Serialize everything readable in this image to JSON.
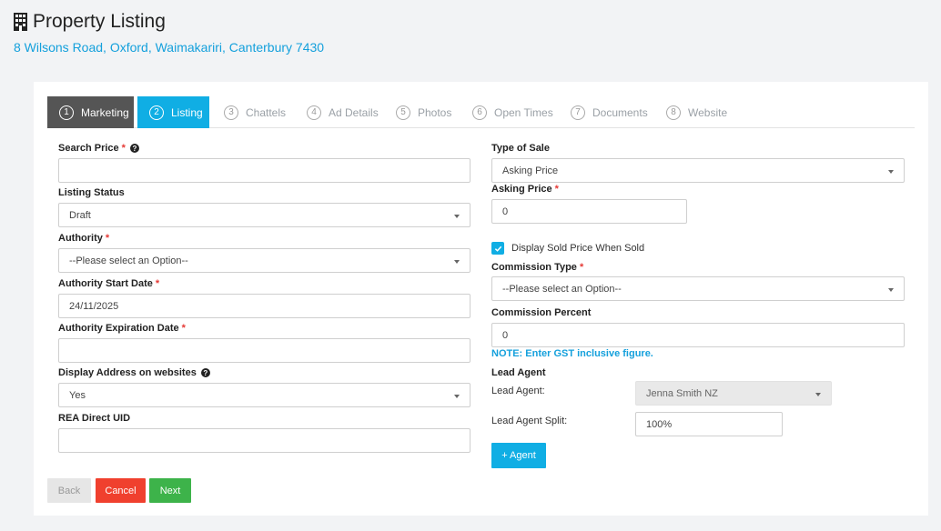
{
  "header": {
    "title": "Property Listing",
    "address": "8 Wilsons Road, Oxford, Waimakariri, Canterbury 7430"
  },
  "tabs": [
    {
      "num": "1",
      "label": "Marketing",
      "state": "done"
    },
    {
      "num": "2",
      "label": "Listing",
      "state": "active"
    },
    {
      "num": "3",
      "label": "Chattels",
      "state": "inactive"
    },
    {
      "num": "4",
      "label": "Ad Details",
      "state": "inactive"
    },
    {
      "num": "5",
      "label": "Photos",
      "state": "inactive"
    },
    {
      "num": "6",
      "label": "Open Times",
      "state": "inactive"
    },
    {
      "num": "7",
      "label": "Documents",
      "state": "inactive"
    },
    {
      "num": "8",
      "label": "Website",
      "state": "inactive"
    }
  ],
  "left": {
    "search_price": {
      "label": "Search Price",
      "value": ""
    },
    "listing_status": {
      "label": "Listing Status",
      "value": "Draft"
    },
    "authority": {
      "label": "Authority",
      "value": "--Please select an Option--"
    },
    "authority_start": {
      "label": "Authority Start Date",
      "value": "24/11/2025"
    },
    "authority_expiry": {
      "label": "Authority Expiration Date",
      "value": ""
    },
    "display_address": {
      "label": "Display Address on websites",
      "value": "Yes"
    },
    "rea_uid": {
      "label": "REA Direct UID",
      "value": ""
    }
  },
  "right": {
    "type_of_sale": {
      "label": "Type of Sale",
      "value": "Asking Price"
    },
    "asking_price": {
      "label": "Asking Price",
      "value": "0"
    },
    "display_sold": {
      "label": "Display Sold Price When Sold",
      "checked": true
    },
    "commission_type": {
      "label": "Commission Type",
      "value": "--Please select an Option--"
    },
    "commission_percent": {
      "label": "Commission Percent",
      "value": "0"
    },
    "note": "NOTE: Enter GST inclusive figure.",
    "lead_agent_heading": "Lead Agent",
    "lead_agent": {
      "label": "Lead Agent:",
      "value": "Jenna Smith NZ"
    },
    "lead_agent_split": {
      "label": "Lead Agent Split:",
      "value": "100%"
    },
    "add_agent_label": "+ Agent"
  },
  "actions": {
    "back": "Back",
    "cancel": "Cancel",
    "next": "Next"
  },
  "colors": {
    "accent": "#10aee4",
    "cancel": "#f0402e",
    "next": "#3db34a",
    "required": "#e53935"
  }
}
